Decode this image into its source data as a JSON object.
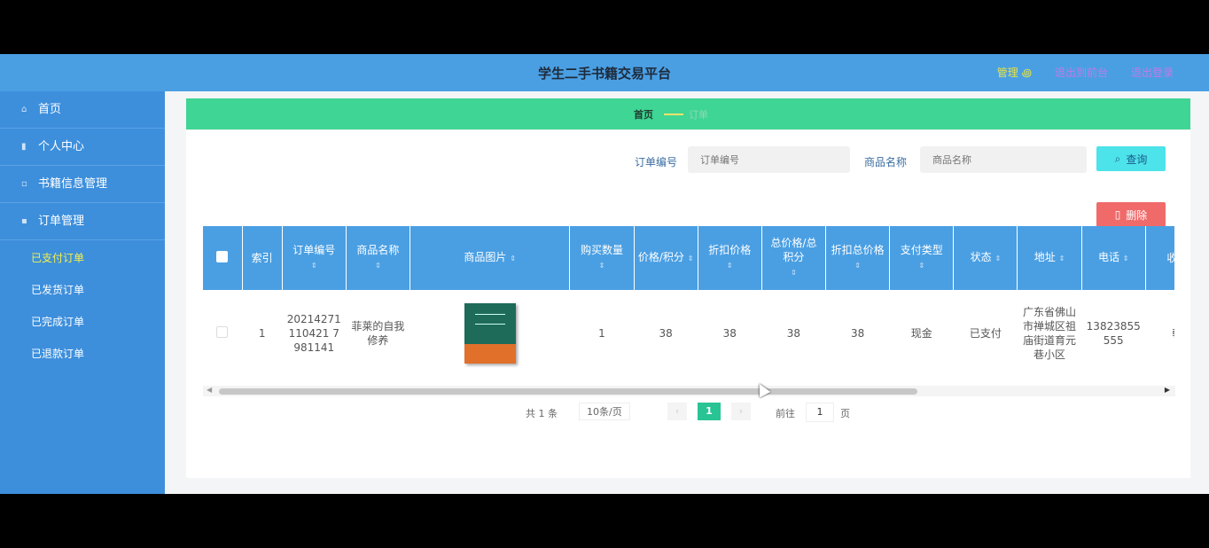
{
  "app": {
    "title": "学生二手书籍交易平台",
    "user_label": "管理 ꩜",
    "link_front": "退出到前台",
    "link_logout": "退出登录"
  },
  "sidebar": {
    "items": [
      {
        "icon": "home-icon",
        "label": "首页"
      },
      {
        "icon": "user-icon",
        "label": "个人中心"
      },
      {
        "icon": "book-icon",
        "label": "书籍信息管理"
      },
      {
        "icon": "order-icon",
        "label": "订单管理"
      }
    ],
    "submenu": [
      {
        "label": "已支付订单",
        "active": true
      },
      {
        "label": "已发货订单",
        "active": false
      },
      {
        "label": "已完成订单",
        "active": false
      },
      {
        "label": "已退款订单",
        "active": false
      }
    ]
  },
  "breadcrumb": {
    "home": "首页",
    "current": "订单"
  },
  "search": {
    "order_label": "订单编号",
    "order_placeholder": "订单编号",
    "product_label": "商品名称",
    "product_placeholder": "商品名称",
    "query_button": "查询",
    "delete_button": "删除"
  },
  "table": {
    "headers": [
      "索引",
      "订单编号",
      "商品名称",
      "商品图片",
      "购买数量",
      "价格/积分",
      "折扣价格",
      "总价格/总积分",
      "折扣总价格",
      "支付类型",
      "状态",
      "地址",
      "电话",
      "收货"
    ],
    "rows": [
      {
        "index": "1",
        "order_no": "20214271110421 7981141",
        "product": "菲莱的自我修养",
        "image_icon": "book-cover-image",
        "quantity": "1",
        "price": "38",
        "discount_price": "38",
        "total": "38",
        "discount_total": "38",
        "pay_type": "现金",
        "status": "已支付",
        "address": "广东省佛山市禅城区祖庙街道育元巷小区",
        "phone": "13823855555",
        "receiver": "韩"
      }
    ]
  },
  "pager": {
    "total": "共 1 条",
    "page_size": "10条/页",
    "prev": "‹",
    "current": "1",
    "next": "›",
    "goto_label": "前往",
    "goto_value": "1",
    "page_suffix": "页"
  },
  "colors": {
    "topbar": "#4a9fe3",
    "sidebar": "#3d8fdc",
    "breadcrumb_bar": "#3fd594",
    "table_header": "#4a9fe3",
    "query_button": "#4de3ea",
    "delete_button": "#f06a6a",
    "pager_active": "#28c494"
  }
}
